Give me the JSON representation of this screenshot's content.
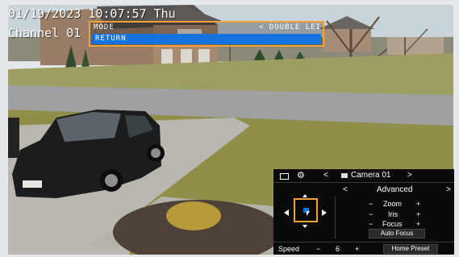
{
  "osd": {
    "timestamp": "01/19/2023 10:07:57 Thu",
    "channel": "Channel 01"
  },
  "menu": {
    "mode_label": "MODE",
    "mode_value": "< DOUBLE LEI",
    "selected_item": "RETURN"
  },
  "ptz_panel": {
    "camera_name": "Camera 01",
    "mode": "Advanced",
    "zoom_label": "Zoom",
    "iris_label": "Iris",
    "focus_label": "Focus",
    "minus": "−",
    "plus": "+",
    "auto_focus_label": "Auto Focus",
    "speed_label": "Speed",
    "speed_value": "6",
    "home_preset_label": "Home Preset",
    "icons": [
      "monitor-icon",
      "gear-icon",
      "camera-icon"
    ]
  },
  "colors": {
    "menu_border": "#f2a13a",
    "menu_highlight": "#1573e0",
    "panel_bg": "#0a0a0a"
  }
}
